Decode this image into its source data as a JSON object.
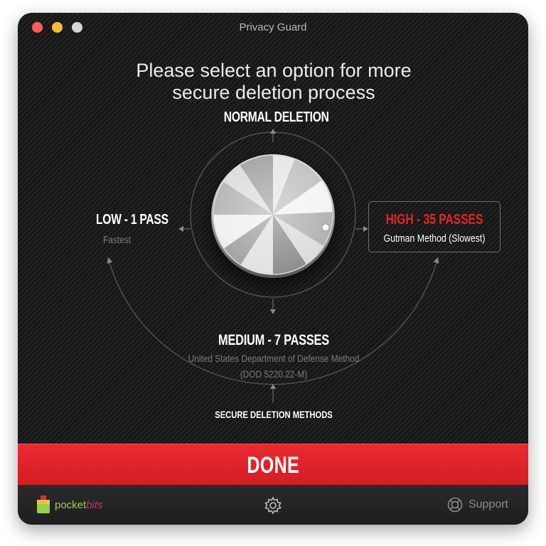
{
  "window": {
    "title": "Privacy Guard"
  },
  "heading": {
    "line1": "Please select an option for more",
    "line2": "secure deletion process"
  },
  "options": {
    "normal": {
      "title": "NORMAL DELETION"
    },
    "low": {
      "title": "LOW - 1 PASS",
      "subtitle": "Fastest"
    },
    "medium": {
      "title": "MEDIUM - 7 PASSES",
      "subtitle_line1": "United States Department of Defense Method",
      "subtitle_line2": "(DOD 5220.22-M)"
    },
    "high": {
      "title": "HIGH - 35 PASSES",
      "subtitle": "Gutman Method (Slowest)",
      "selected": true
    }
  },
  "methods_label": "SECURE DELETION METHODS",
  "done_button": {
    "label": "DONE"
  },
  "footer": {
    "brand_a": "pocket",
    "brand_b": "bits",
    "settings_icon": "gear-icon",
    "support_label": "Support",
    "support_icon": "lifebuoy-icon"
  },
  "colors": {
    "accent": "#e3242b",
    "background": "#1c1c1c",
    "brand_green": "#9bd04c",
    "brand_pink": "#e0246a"
  }
}
